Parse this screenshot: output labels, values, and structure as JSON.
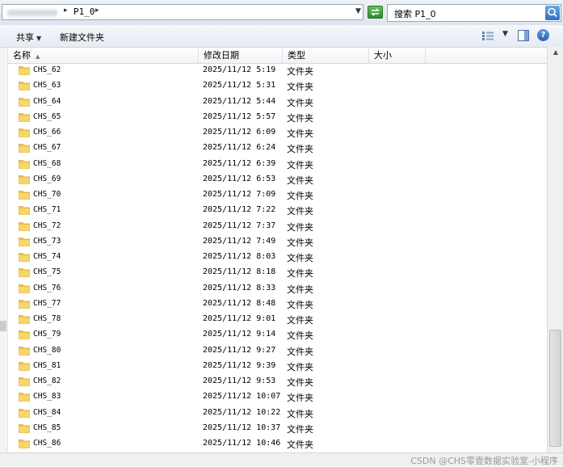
{
  "address_bar": {
    "separator": "▸",
    "path": "P1_0",
    "chevron": "▸",
    "dropdown": "▼",
    "go_icon": "refresh-arrow-icon"
  },
  "search": {
    "text": "搜索 P1_0",
    "icon": "magnifier-icon"
  },
  "command_bar": {
    "share_label": "共享",
    "share_chevron": "▼",
    "new_folder_label": "新建文件夹",
    "view_dropdown": "▼",
    "help_label": "?"
  },
  "columns": {
    "name": "名称",
    "sort_arrow": "▲",
    "date": "修改日期",
    "type": "类型",
    "size": "大小"
  },
  "rows": [
    {
      "name": "CHS_62",
      "date": "2025/11/12 5:19",
      "type": "文件夹"
    },
    {
      "name": "CHS_63",
      "date": "2025/11/12 5:31",
      "type": "文件夹"
    },
    {
      "name": "CHS_64",
      "date": "2025/11/12 5:44",
      "type": "文件夹"
    },
    {
      "name": "CHS_65",
      "date": "2025/11/12 5:57",
      "type": "文件夹"
    },
    {
      "name": "CHS_66",
      "date": "2025/11/12 6:09",
      "type": "文件夹"
    },
    {
      "name": "CHS_67",
      "date": "2025/11/12 6:24",
      "type": "文件夹"
    },
    {
      "name": "CHS_68",
      "date": "2025/11/12 6:39",
      "type": "文件夹"
    },
    {
      "name": "CHS_69",
      "date": "2025/11/12 6:53",
      "type": "文件夹"
    },
    {
      "name": "CHS_70",
      "date": "2025/11/12 7:09",
      "type": "文件夹"
    },
    {
      "name": "CHS_71",
      "date": "2025/11/12 7:22",
      "type": "文件夹"
    },
    {
      "name": "CHS_72",
      "date": "2025/11/12 7:37",
      "type": "文件夹"
    },
    {
      "name": "CHS_73",
      "date": "2025/11/12 7:49",
      "type": "文件夹"
    },
    {
      "name": "CHS_74",
      "date": "2025/11/12 8:03",
      "type": "文件夹"
    },
    {
      "name": "CHS_75",
      "date": "2025/11/12 8:18",
      "type": "文件夹"
    },
    {
      "name": "CHS_76",
      "date": "2025/11/12 8:33",
      "type": "文件夹"
    },
    {
      "name": "CHS_77",
      "date": "2025/11/12 8:48",
      "type": "文件夹"
    },
    {
      "name": "CHS_78",
      "date": "2025/11/12 9:01",
      "type": "文件夹"
    },
    {
      "name": "CHS_79",
      "date": "2025/11/12 9:14",
      "type": "文件夹"
    },
    {
      "name": "CHS_80",
      "date": "2025/11/12 9:27",
      "type": "文件夹"
    },
    {
      "name": "CHS_81",
      "date": "2025/11/12 9:39",
      "type": "文件夹"
    },
    {
      "name": "CHS_82",
      "date": "2025/11/12 9:53",
      "type": "文件夹"
    },
    {
      "name": "CHS_83",
      "date": "2025/11/12 10:07",
      "type": "文件夹"
    },
    {
      "name": "CHS_84",
      "date": "2025/11/12 10:22",
      "type": "文件夹"
    },
    {
      "name": "CHS_85",
      "date": "2025/11/12 10:37",
      "type": "文件夹"
    },
    {
      "name": "CHS_86",
      "date": "2025/11/12 10:46",
      "type": "文件夹"
    }
  ],
  "scrollbar": {
    "up_arrow": "▲"
  },
  "watermark": "CSDN @CHS零壹数据实验室-小程序",
  "colors": {
    "folder": "#f0c44c",
    "folder_dark": "#d9a42a",
    "go_button": "#3da53a",
    "accent_blue": "#2f6fc0"
  }
}
